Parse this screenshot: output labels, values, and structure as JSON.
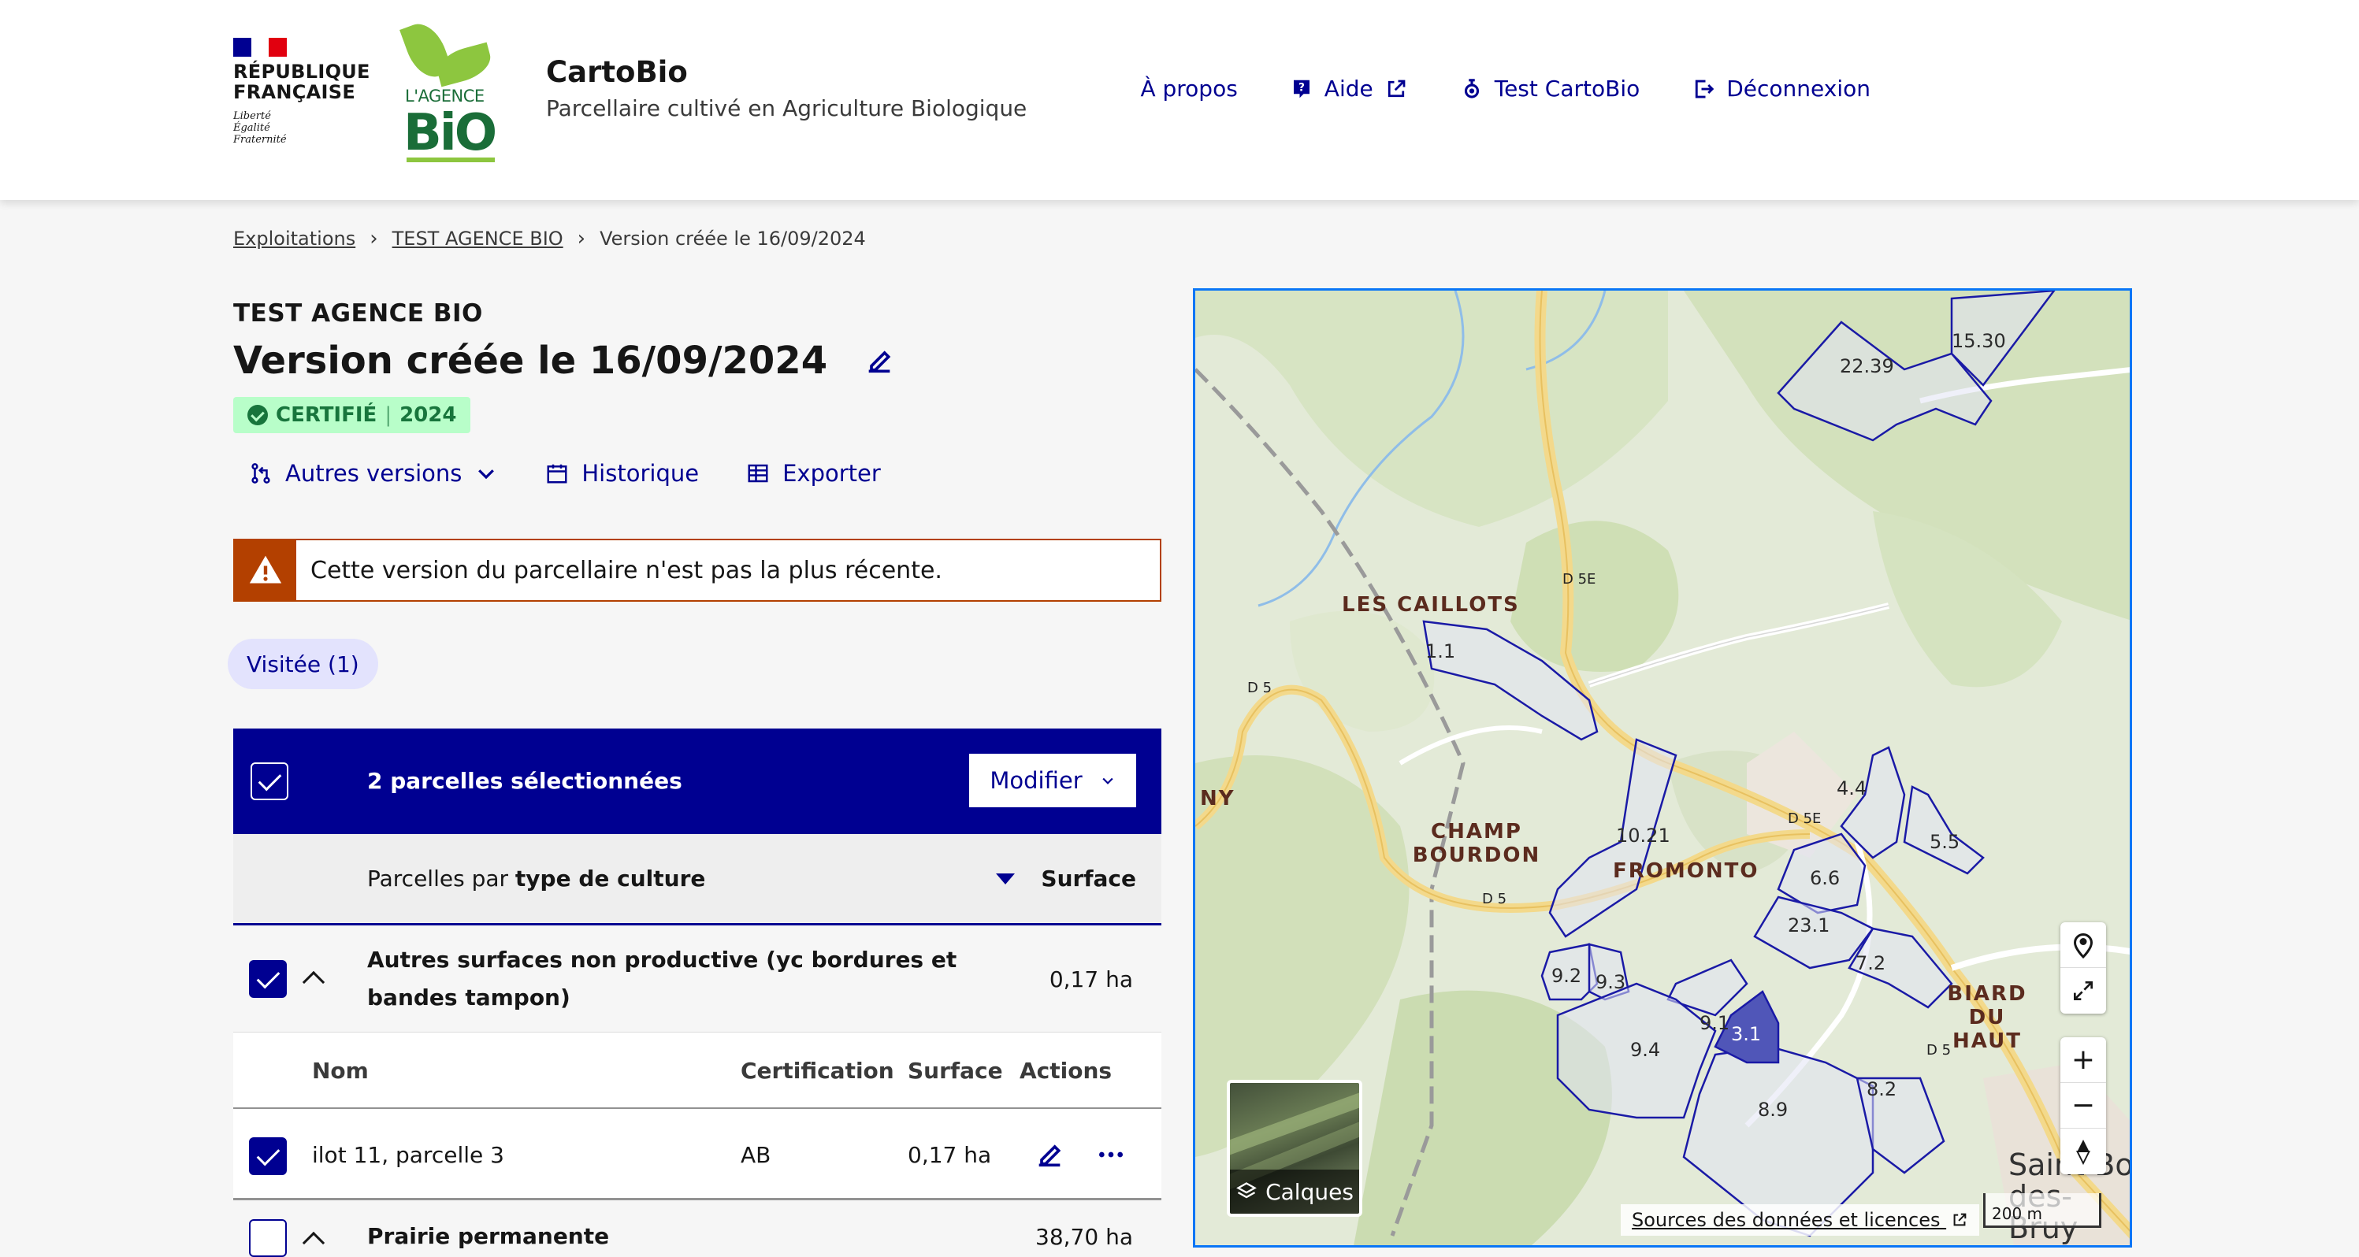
{
  "header": {
    "marianne_line1": "RÉPUBLIQUE",
    "marianne_line2": "FRANÇAISE",
    "devise1": "Liberté",
    "devise2": "Égalité",
    "devise3": "Fraternité",
    "agence_small": "L'AGENCE",
    "agence_big": "BiO",
    "app_title": "CartoBio",
    "tagline": "Parcellaire cultivé en Agriculture Biologique",
    "nav": [
      {
        "label": "À propos",
        "icon": "none"
      },
      {
        "label": "Aide",
        "icon": "help-icon"
      },
      {
        "label": "Test CartoBio",
        "icon": "flask-icon"
      },
      {
        "label": "Déconnexion",
        "icon": "logout-icon"
      }
    ]
  },
  "breadcrumb": {
    "items": [
      "Exploitations",
      "TEST AGENCE BIO",
      "Version créée le 16/09/2024"
    ]
  },
  "operator": {
    "name": "TEST AGENCE BIO",
    "version_title": "Version créée le 16/09/2024",
    "badge_status": "CERTIFIÉ",
    "badge_year": "2024"
  },
  "actions": {
    "other_versions": "Autres versions",
    "history": "Historique",
    "export": "Exporter"
  },
  "alert": {
    "text": "Cette version du parcellaire n'est pas la plus récente."
  },
  "filter": {
    "label": "Visitée (1)"
  },
  "table": {
    "selection_text": "2 parcelles sélectionnées",
    "modify_label": "Modifier",
    "group_by_prefix": "Parcelles par ",
    "group_by_bold": "type de culture",
    "surface_header": "Surface",
    "groups": [
      {
        "name": "Autres surfaces non productive (yc bordures et bandes tampon)",
        "area": "0,17 ha"
      },
      {
        "name": "Prairie permanente",
        "area": "38,70 ha"
      }
    ],
    "sub_headers": {
      "name": "Nom",
      "certification": "Certification",
      "surface": "Surface",
      "actions": "Actions"
    },
    "rows": [
      {
        "name": "ilot 11, parcelle 3",
        "certification": "AB",
        "surface": "0,17 ha"
      }
    ]
  },
  "map": {
    "places": [
      "LES CAILLOTS",
      "CHAMP BOURDON",
      "FROMONTO",
      "BIARD DU HAUT",
      "NY"
    ],
    "roads": [
      "D 5E",
      "D 5",
      "D 5",
      "D 5E",
      "D 5"
    ],
    "parcels": [
      "22.39",
      "15.30",
      "1.1",
      "10.21",
      "4.4",
      "5.5",
      "6.6",
      "23.1",
      "7.2",
      "9.2",
      "9.3",
      "9.1",
      "3.1",
      "9.4",
      "8.2",
      "8.9"
    ],
    "town": "Saint-Bo des-Bruy",
    "layers_label": "Calques",
    "sources_label": "Sources des données et licences",
    "scale_label": "200 m",
    "zoom_in": "+",
    "zoom_out": "−"
  },
  "colors": {
    "primary": "#000091",
    "certified_bg": "#b8fec9",
    "certified_fg": "#18753c",
    "warning": "#b34000",
    "map_border": "#0a76f6"
  }
}
